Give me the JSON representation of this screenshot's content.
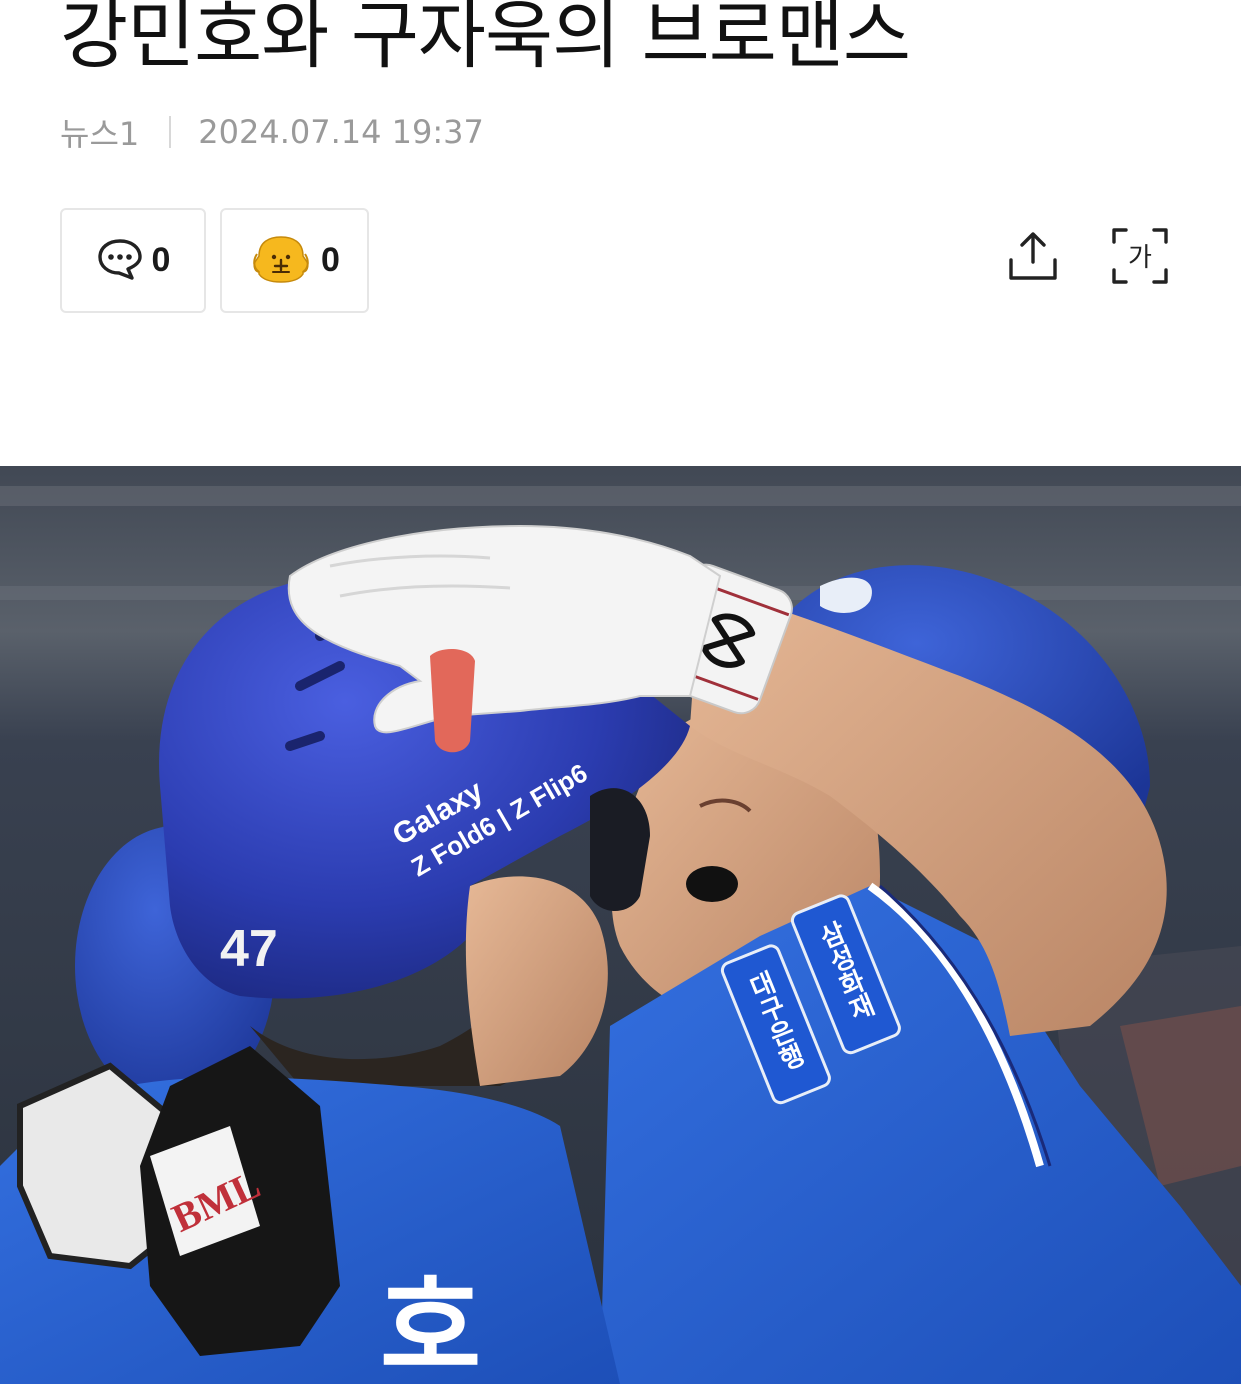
{
  "article": {
    "title": "강민호와 구자욱의 브로맨스",
    "source": "뉴스1",
    "datetime": "2024.07.14 19:37"
  },
  "reactions": {
    "comment_icon": "speech-bubble-icon",
    "comment_count": "0",
    "like_icon": "dog-face-icon",
    "like_count": "0"
  },
  "toolbar": {
    "share_icon": "share-upload-icon",
    "text_size_icon": "text-size-icon",
    "text_size_glyph": "가"
  },
  "photo": {
    "helmet_text_1": "Galaxy",
    "helmet_text_2": "Z Fold6 | Z Flip6",
    "helmet_number": "47",
    "sleeve_text_1": "삼성화재",
    "sleeve_text_2": "대구은행",
    "jersey_text": "호",
    "glove_brand": "BML",
    "colors": {
      "jersey_blue": "#2a5fd3",
      "helmet_blue": "#2b3fb5",
      "background": "#3a4250"
    }
  }
}
